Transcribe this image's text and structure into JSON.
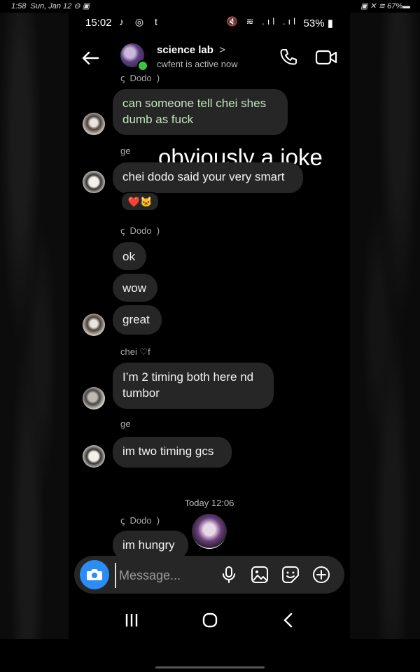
{
  "outer_status": {
    "time": "1:58",
    "date": "Sun, Jan 12",
    "battery": "67%"
  },
  "status_bar": {
    "time": "15:02",
    "battery": "53%",
    "app_icons": "♪ ◎ t"
  },
  "header": {
    "title": "science lab",
    "chevron": ">",
    "subtitle": "cwfent is active now"
  },
  "messages": {
    "sender_top": "Dodo",
    "msg1": "can someone tell chei shes dumb as fuck",
    "sender_ge1": "ge",
    "overlay": "obviously a joke",
    "msg2": "chei dodo said your very smart",
    "reactions": "❤️🐱",
    "sender_dodo": "Dodo",
    "msg3": "ok",
    "msg4": "wow",
    "msg5": "great",
    "sender_chei": "chei ♡f",
    "msg6": "I’m 2 timing both here nd tumbor",
    "sender_ge2": "ge",
    "msg7": "im two timing gcs",
    "timestamp": "Today 12:06",
    "sender_dodo2": "Dodo",
    "msg8": "im hungry"
  },
  "composer": {
    "placeholder": "Message..."
  },
  "colors": {
    "bubble": "#262626",
    "accent": "#2a8df5",
    "active": "#3ec33e"
  },
  "icons": [
    "back-arrow-icon",
    "phone-icon",
    "video-icon",
    "camera-icon",
    "microphone-icon",
    "image-icon",
    "sticker-icon",
    "plus-icon",
    "recents-icon",
    "home-icon",
    "nav-back-icon"
  ]
}
